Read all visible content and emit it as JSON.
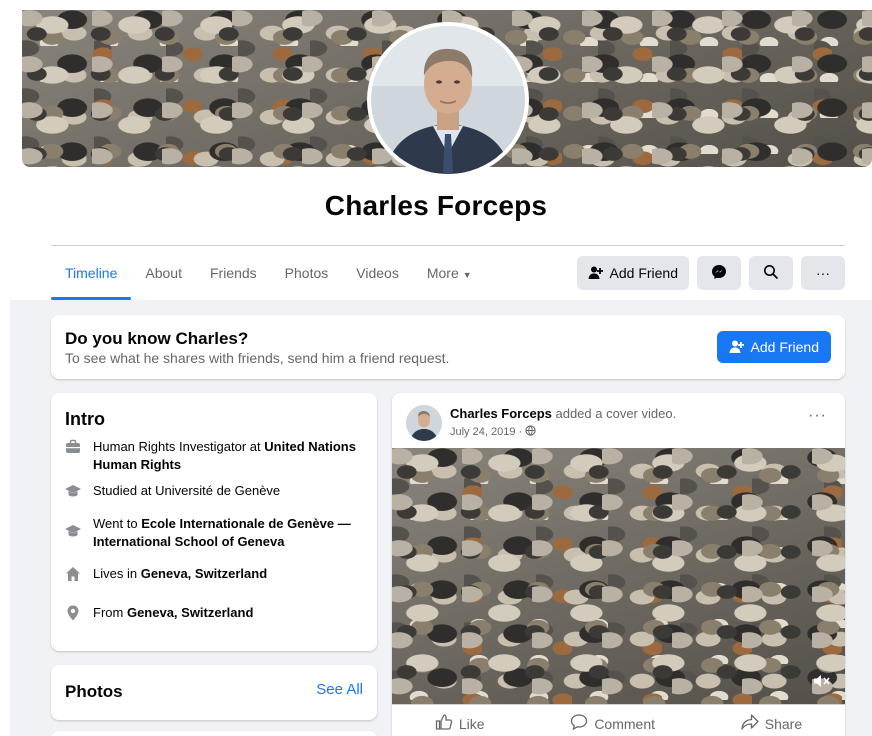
{
  "profile": {
    "name": "Charles Forceps"
  },
  "tabs": [
    {
      "label": "Timeline"
    },
    {
      "label": "About"
    },
    {
      "label": "Friends"
    },
    {
      "label": "Photos"
    },
    {
      "label": "Videos"
    },
    {
      "label": "More"
    }
  ],
  "actions": {
    "add_friend": "Add Friend",
    "messenger_icon": "messenger-icon",
    "search_icon": "search-icon",
    "more": "···"
  },
  "know": {
    "title": "Do you know Charles?",
    "subtitle": "To see what he shares with friends, send him a friend request.",
    "button": "Add Friend"
  },
  "intro": {
    "title": "Intro",
    "items": [
      {
        "icon": "briefcase-icon",
        "prefix": "Human Rights Investigator at ",
        "strong": "United Nations Human Rights"
      },
      {
        "icon": "graduation-cap-icon",
        "prefix": "Studied at ",
        "strong": "Université de Genève"
      },
      {
        "icon": "graduation-cap-icon",
        "prefix": "Went to ",
        "strong": "Ecole Internationale de Genève — International School of Geneva"
      },
      {
        "icon": "home-icon",
        "prefix": "Lives in ",
        "strong": "Geneva, Switzerland"
      },
      {
        "icon": "location-pin-icon",
        "prefix": "From ",
        "strong": "Geneva, Switzerland"
      }
    ]
  },
  "photos": {
    "title": "Photos",
    "see_all": "See All"
  },
  "post": {
    "author": "Charles Forceps",
    "action": " added a cover video.",
    "date": "July 24, 2019 ·",
    "more": "···",
    "like": "Like",
    "comment": "Comment",
    "share": "Share"
  },
  "colors": {
    "accent": "#1877f2",
    "background": "#f0f2f5",
    "secondary_text": "#65676b"
  }
}
